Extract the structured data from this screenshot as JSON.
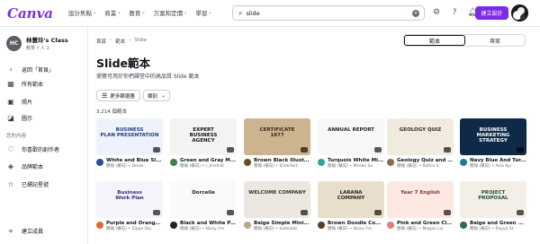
{
  "header": {
    "logo": "Canva",
    "nav": [
      "設計焦點",
      "商業",
      "教育",
      "方案和定價",
      "學習"
    ],
    "search": {
      "icon": "search-icon",
      "value": "slide"
    },
    "create_label": "建立設計"
  },
  "sidebar": {
    "team_name": "林蕙玲's Class",
    "team_initials": "HC",
    "team_sub": "教育 • 人 2",
    "back": "返回「首頁」",
    "items": [
      {
        "label": "所有範本",
        "icon": "template-icon"
      },
      {
        "label": "照片",
        "icon": "photo-icon"
      },
      {
        "label": "圖示",
        "icon": "shapes-icon"
      }
    ],
    "section": "您的內容",
    "content_items": [
      {
        "label": "你喜歡的創作者",
        "icon": "heart-icon"
      },
      {
        "label": "品牌範本",
        "icon": "brand-icon"
      },
      {
        "label": "已標記星號",
        "icon": "star-icon"
      }
    ],
    "create_team": "建立成員"
  },
  "main": {
    "breadcrumb": [
      "首頁",
      "範本",
      "Slide"
    ],
    "toggle": {
      "active": "範本",
      "inactive": "專案"
    },
    "title": "Slide範本",
    "subtitle": "瀏覽可用於你們課堂中的高品質 Slide 範本",
    "filter_label": "更多篩選器",
    "type_label": "類別",
    "count": "3,214 個範本"
  },
  "cards": [
    {
      "title": "White and Blue Sl...",
      "author": "簡報 (橫向) • Derwi",
      "thumb_text": "BUSINESS\nPLAN PRESENTATION",
      "bg": "#eef3fb",
      "fg": "#1d3b8b",
      "avatar": "#2b4c9b"
    },
    {
      "title": "Green and Gray M...",
      "author": "簡報 (橫向) • r_kristrat",
      "thumb_text": "EXPERT\nBUSINESS\nAGENCY",
      "bg": "#f4f4f4",
      "fg": "#111111",
      "avatar": "#3f7d4b"
    },
    {
      "title": "Brown Black Illustr...",
      "author": "簡報 (橫向) • SlideFact",
      "thumb_text": "CERTIFICATE\n1877",
      "bg": "#cdb48e",
      "fg": "#3b2a17",
      "avatar": "#6a4b2a"
    },
    {
      "title": "Turquois White Mi...",
      "author": "簡報 (橫向) • Meoke Sa",
      "thumb_text": "ANNUAL REPORT",
      "bg": "#f7f7f5",
      "fg": "#222222",
      "avatar": "#2aa6a1"
    },
    {
      "title": "Geology Quiz and F...",
      "author": "簡報 (橫向) • Rafico S",
      "thumb_text": "GEOLOGY QUIZ",
      "bg": "#f0eadf",
      "fg": "#2e2b2a",
      "avatar": "#8a6f4e"
    },
    {
      "title": "Navy Blue And Tur...",
      "author": "簡報 (橫向) • Asia Kyr",
      "thumb_text": "BUSINESS\nMARKETING\nSTRATEGY",
      "bg": "#0f2a46",
      "fg": "#ffffff",
      "avatar": "#1a7f8e"
    },
    {
      "title": "Purple and Orange ...",
      "author": "簡報 (橫向) • Zippo Stu",
      "thumb_text": "Business\nWork Plan",
      "bg": "#f6f4fa",
      "fg": "#3a2b7a",
      "avatar": "#e06a2c"
    },
    {
      "title": "Black and White Pa...",
      "author": "簡報 (橫向) • Noisy Fre",
      "thumb_text": "Dorcelle",
      "bg": "#fafafa",
      "fg": "#222222",
      "avatar": "#222222"
    },
    {
      "title": "Beige Simple Mini...",
      "author": "簡報 (橫向) • katelabb",
      "thumb_text": "WELCOME COMPANY",
      "bg": "#ece7e0",
      "fg": "#333333",
      "avatar": "#b9a68b"
    },
    {
      "title": "Brown Doodle Co...",
      "author": "簡報 (橫向) • Noisy Fre",
      "thumb_text": "LARANA\nCOMPANY",
      "bg": "#e9ddcc",
      "fg": "#2b2621",
      "avatar": "#5b3d26"
    },
    {
      "title": "Pink and Green Cla...",
      "author": "簡報 (橫向) • Megan Liv",
      "thumb_text": "Year 7 English",
      "bg": "#fde9e2",
      "fg": "#7a3a32",
      "avatar": "#e37a80"
    },
    {
      "title": "Beige and Green ...",
      "author": "簡報 (橫向) • Rayya St",
      "thumb_text": "PROJECT\nPROPOSAL",
      "bg": "#f3efe6",
      "fg": "#1f4a35",
      "avatar": "#2d6b49"
    }
  ]
}
